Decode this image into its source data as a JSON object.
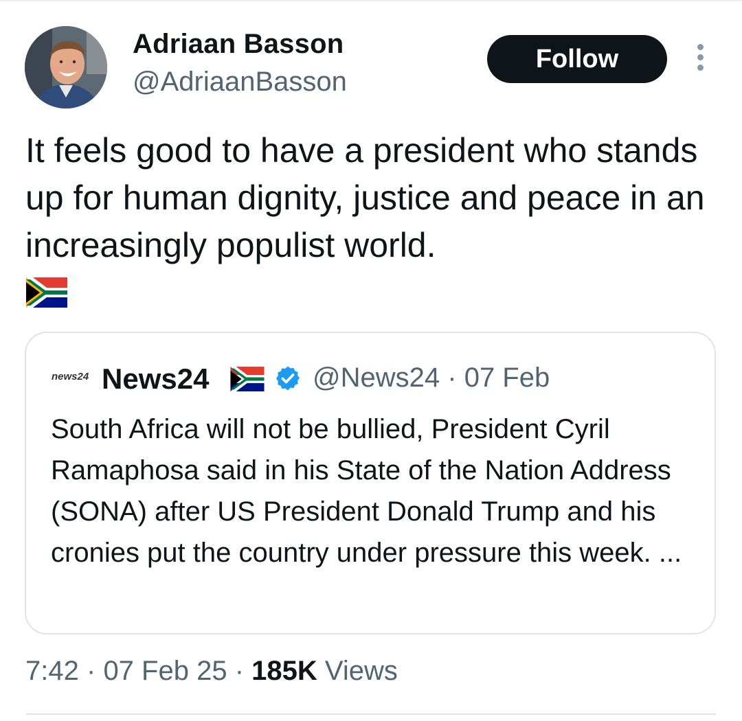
{
  "tweet": {
    "author_name": "Adriaan Basson",
    "author_handle": "@AdriaanBasson",
    "follow_label": "Follow",
    "text": "It feels good to have a president who stands up for human dignity, justice and peace in an increasingly populist world.",
    "flag_icon": "south-africa-flag-icon",
    "time": "7:42",
    "date": "07 Feb 25",
    "views_count": "185K",
    "views_label": "Views",
    "separator": "·"
  },
  "quoted_tweet": {
    "logo_text": "news24",
    "logo_superscript": "24",
    "author_name": "News24",
    "verified_icon": "verified-badge-icon",
    "author_handle": "@News24",
    "date": "07 Feb",
    "separator": "·",
    "text": "South Africa will not be bullied, President Cyril Ramaphosa said in his State of the Nation Address (SONA) after US President Donald Trump and his cronies put the country under pressure this week. ..."
  },
  "colors": {
    "primary_text": "#0f1419",
    "secondary_text": "#536471",
    "follow_bg": "#0f1419",
    "verified_blue": "#1d9bf0",
    "border": "#dfe4e8"
  }
}
